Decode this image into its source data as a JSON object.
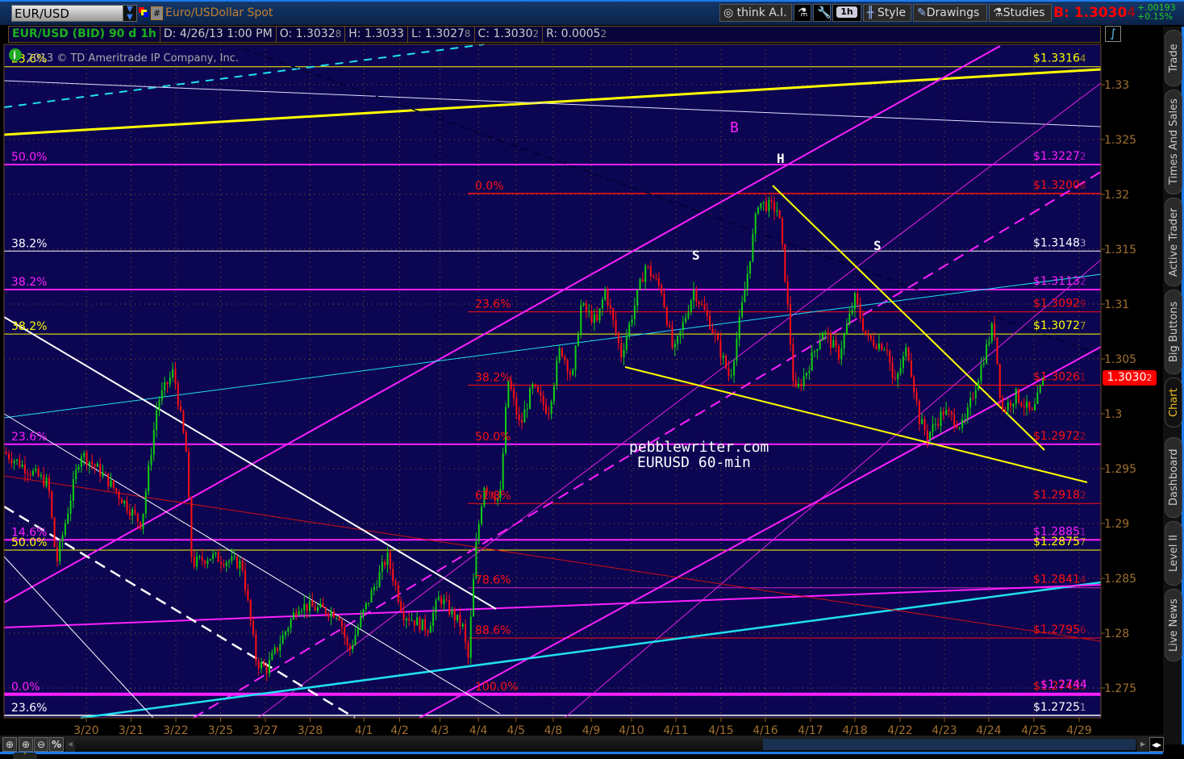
{
  "toolbar": {
    "symbol": "EUR/USD",
    "description": "Euro/USDollar Spot",
    "hash_label": "#",
    "think_ai": "think A.I.",
    "timeframe": "1h",
    "style": "Style",
    "drawings": "Drawings",
    "studies": "Studies",
    "bid_label": "B: 1.3030",
    "bid_sub": "4",
    "change_abs": "+.00193",
    "change_pct": "+0.15%"
  },
  "infobar": {
    "title": "EUR/USD (BID) 90 d 1h",
    "date": "D: 4/26/13 1:00 PM",
    "open": "O: 1.3032",
    "open_sub": "8",
    "high": "H: 1.3033",
    "low": "L: 1.3027",
    "low_sub": "8",
    "close": "C: 1.3030",
    "close_sub": "2",
    "range": "R: 0.0005",
    "range_sub": "2"
  },
  "copyright": "2013 © TD Ameritrade IP Company, Inc.",
  "current_price": {
    "main": "1.3030",
    "sub": "2"
  },
  "sidebar_tabs": [
    "Trade",
    "Times And Sales",
    "Active Trader",
    "Big Buttons",
    "Chart",
    "Dashboard",
    "Level II",
    "Live News"
  ],
  "active_tab": "Chart",
  "annotations": {
    "B": "B",
    "H": "H",
    "S1": "S",
    "S2": "S",
    "watermark1": "pebblewriter.com",
    "watermark2": "EURUSD 60-min"
  },
  "zoom_buttons": [
    "crosshair-icon",
    "zoom-in-icon",
    "zoom-out-icon",
    "%"
  ],
  "colors": {
    "background": "#0c0552",
    "up": "#10d010",
    "down": "#ff1010",
    "magenta": "#ff20ff",
    "yellow": "#ffff00",
    "cyan": "#20e0f0",
    "red": "#ff1010",
    "axis": "#a07030"
  },
  "chart_data": {
    "type": "candlestick",
    "title": "EUR/USD (BID) 90 d 1h",
    "x_unit": "trading days offset from 3/20",
    "xlim": [
      -1.84,
      22.67
    ],
    "ylim": [
      1.2711,
      1.3353
    ],
    "x_ticks": [
      {
        "o": 0,
        "label": "3/20"
      },
      {
        "o": 1,
        "label": "3/21"
      },
      {
        "o": 2,
        "label": "3/22"
      },
      {
        "o": 3,
        "label": "3/25"
      },
      {
        "o": 4,
        "label": "3/27"
      },
      {
        "o": 5,
        "label": "3/28"
      },
      {
        "o": 6.2,
        "label": "4/1"
      },
      {
        "o": 7,
        "label": "4/2"
      },
      {
        "o": 7.9,
        "label": "4/3"
      },
      {
        "o": 8.76,
        "label": "4/4"
      },
      {
        "o": 9.6,
        "label": "4/5"
      },
      {
        "o": 10.43,
        "label": "4/8"
      },
      {
        "o": 11.28,
        "label": "4/9"
      },
      {
        "o": 12.18,
        "label": "4/10"
      },
      {
        "o": 13.17,
        "label": "4/11"
      },
      {
        "o": 14.18,
        "label": "4/15"
      },
      {
        "o": 15.17,
        "label": "4/16"
      },
      {
        "o": 16.18,
        "label": "4/17"
      },
      {
        "o": 17.17,
        "label": "4/18"
      },
      {
        "o": 18.18,
        "label": "4/22"
      },
      {
        "o": 19.17,
        "label": "4/23"
      },
      {
        "o": 20.16,
        "label": "4/24"
      },
      {
        "o": 21.17,
        "label": "4/25"
      },
      {
        "o": 22.18,
        "label": "4/29"
      }
    ],
    "y_ticks": [
      "1.33",
      "1.325",
      "1.32",
      "1.315",
      "1.31",
      "1.305",
      "1.3",
      "1.295",
      "1.29",
      "1.285",
      "1.28",
      "1.275"
    ],
    "price_path": [
      [
        -1.84,
        1.2965
      ],
      [
        -0.85,
        1.2936
      ],
      [
        -0.67,
        1.2863
      ],
      [
        -0.13,
        1.2965
      ],
      [
        0.41,
        1.2943
      ],
      [
        1.23,
        1.2899
      ],
      [
        1.59,
        1.301
      ],
      [
        1.95,
        1.3039
      ],
      [
        2.23,
        1.2965
      ],
      [
        2.36,
        1.2863
      ],
      [
        2.76,
        1.287
      ],
      [
        3.48,
        1.2863
      ],
      [
        3.8,
        1.2774
      ],
      [
        4.02,
        1.2767
      ],
      [
        4.38,
        1.2796
      ],
      [
        4.74,
        1.2826
      ],
      [
        5.64,
        1.2818
      ],
      [
        5.86,
        1.2782
      ],
      [
        6.18,
        1.2818
      ],
      [
        6.72,
        1.287
      ],
      [
        7.08,
        1.2818
      ],
      [
        7.62,
        1.2804
      ],
      [
        7.89,
        1.2833
      ],
      [
        8.43,
        1.2804
      ],
      [
        8.52,
        1.2771
      ],
      [
        8.7,
        1.2877
      ],
      [
        8.88,
        1.2936
      ],
      [
        9.24,
        1.2921
      ],
      [
        9.42,
        1.3032
      ],
      [
        9.69,
        1.2988
      ],
      [
        9.96,
        1.3024
      ],
      [
        10.32,
        1.3002
      ],
      [
        10.59,
        1.3061
      ],
      [
        10.86,
        1.3032
      ],
      [
        11.05,
        1.3098
      ],
      [
        11.41,
        1.3083
      ],
      [
        11.59,
        1.3113
      ],
      [
        11.95,
        1.3054
      ],
      [
        12.49,
        1.3135
      ],
      [
        12.85,
        1.3113
      ],
      [
        13.12,
        1.3054
      ],
      [
        13.57,
        1.3113
      ],
      [
        13.93,
        1.3083
      ],
      [
        14.38,
        1.3032
      ],
      [
        14.74,
        1.312
      ],
      [
        15.01,
        1.3193
      ],
      [
        15.46,
        1.3186
      ],
      [
        15.64,
        1.3113
      ],
      [
        15.82,
        1.3017
      ],
      [
        16.09,
        1.3039
      ],
      [
        16.45,
        1.3076
      ],
      [
        16.81,
        1.3054
      ],
      [
        17.17,
        1.3105
      ],
      [
        17.44,
        1.3068
      ],
      [
        17.89,
        1.3061
      ],
      [
        18.04,
        1.3024
      ],
      [
        18.34,
        1.3061
      ],
      [
        18.61,
        1.2995
      ],
      [
        18.79,
        1.298
      ],
      [
        19.15,
        1.3002
      ],
      [
        19.6,
        1.2988
      ],
      [
        19.96,
        1.3039
      ],
      [
        20.27,
        1.3083
      ],
      [
        20.45,
        1.3002
      ],
      [
        20.77,
        1.3017
      ],
      [
        21.14,
        1.2999
      ],
      [
        21.41,
        1.3035
      ]
    ],
    "levels": [
      {
        "price": 1.33164,
        "color": "#ffff00",
        "w": 1,
        "from": "left",
        "right_label": "$1.3316",
        "right_sub": "4",
        "left_label": "23.6%",
        "left_color": "#ffff00"
      },
      {
        "price": 1.32272,
        "color": "#ff20ff",
        "w": 2,
        "from": "left",
        "right_label": "$1.3227",
        "right_sub": "2",
        "left_label": "50.0%",
        "left_color": "#ff20ff"
      },
      {
        "price": 1.32008,
        "color": "#ff1010",
        "w": 1.5,
        "from": "fib",
        "right_label": "$1.3200",
        "right_sub": "8",
        "left_label": "0.0%",
        "left_color": "#ff1010"
      },
      {
        "price": 1.31483,
        "color": "#ffffff",
        "w": 1,
        "from": "left",
        "right_label": "$1.3148",
        "right_sub": "3",
        "left_label": "38.2%",
        "left_color": "#ffffff"
      },
      {
        "price": 1.31132,
        "color": "#ff20ff",
        "w": 2,
        "from": "left",
        "right_label": "$1.3113",
        "right_sub": "2",
        "left_label": "38.2%",
        "left_color": "#ff20ff"
      },
      {
        "price": 1.30929,
        "color": "#ff1010",
        "w": 1,
        "from": "fib",
        "right_label": "$1.3092",
        "right_sub": "9",
        "left_label": "23.6%",
        "left_color": "#ff1010"
      },
      {
        "price": 1.30727,
        "color": "#ffff00",
        "w": 1,
        "from": "left",
        "right_label": "$1.3072",
        "right_sub": "7",
        "left_label": "38.2%",
        "left_color": "#ffff00"
      },
      {
        "price": 1.30261,
        "color": "#ff1010",
        "w": 1,
        "from": "fib",
        "right_label": "$1.3026",
        "right_sub": "1",
        "left_label": "38.2%",
        "left_color": "#ff1010"
      },
      {
        "price": 1.29722,
        "color": "#ff20ff",
        "w": 2,
        "from": "left",
        "right_label": "$1.2972",
        "right_sub": "2",
        "left_label": "23.6%",
        "left_color": "#ff20ff",
        "right_color": "#ff1010"
      },
      {
        "price": 1.29722,
        "color": "#ff20ff",
        "w": 0,
        "from": "fib",
        "left_label": "50.0%",
        "left_color": "#ff1010"
      },
      {
        "price": 1.29182,
        "color": "#ff1010",
        "w": 1,
        "from": "fib",
        "right_label": "$1.2918",
        "right_sub": "2",
        "left_label": "61.8%",
        "left_color": "#ff1010"
      },
      {
        "price": 1.28851,
        "color": "#ff20ff",
        "w": 2,
        "from": "left",
        "right_label": "$1.2885",
        "right_sub": "1",
        "left_label": "14.6%",
        "left_color": "#ff20ff"
      },
      {
        "price": 1.28757,
        "color": "#ffff00",
        "w": 1,
        "from": "left",
        "right_label": "$1.2875",
        "right_sub": "7",
        "left_label": "50.0%",
        "left_color": "#ffff00"
      },
      {
        "price": 1.28414,
        "color": "#d020c0",
        "w": 1,
        "from": "fib",
        "right_label": "$1.2841",
        "right_sub": "4",
        "left_label": "78.6%",
        "left_color": "#ff1010",
        "right_color": "#ff1010"
      },
      {
        "price": 1.27956,
        "color": "#ff1010",
        "w": 1,
        "from": "fib",
        "right_label": "$1.2795",
        "right_sub": "6",
        "left_label": "88.6%",
        "left_color": "#ff1010"
      },
      {
        "price": 1.27443,
        "color": "#ff1010",
        "w": 0,
        "from": "fib",
        "right_label": "$1.2743",
        "right_sub": "3",
        "left_label": "100.0%",
        "left_color": "#ff1010"
      },
      {
        "price": 1.27443,
        "color": "#ff20ff",
        "w": 4,
        "from": "left",
        "right_label": "$1.2744",
        "right_sub": "",
        "left_label": "0.0%",
        "left_color": "#ff20ff",
        "right_offset": true
      },
      {
        "price": 1.27251,
        "color": "#ffffff",
        "w": 1.5,
        "from": "left",
        "right_label": "$1.2725",
        "right_sub": "1",
        "left_label": "23.6%",
        "left_color": "#ffffff"
      }
    ]
  }
}
